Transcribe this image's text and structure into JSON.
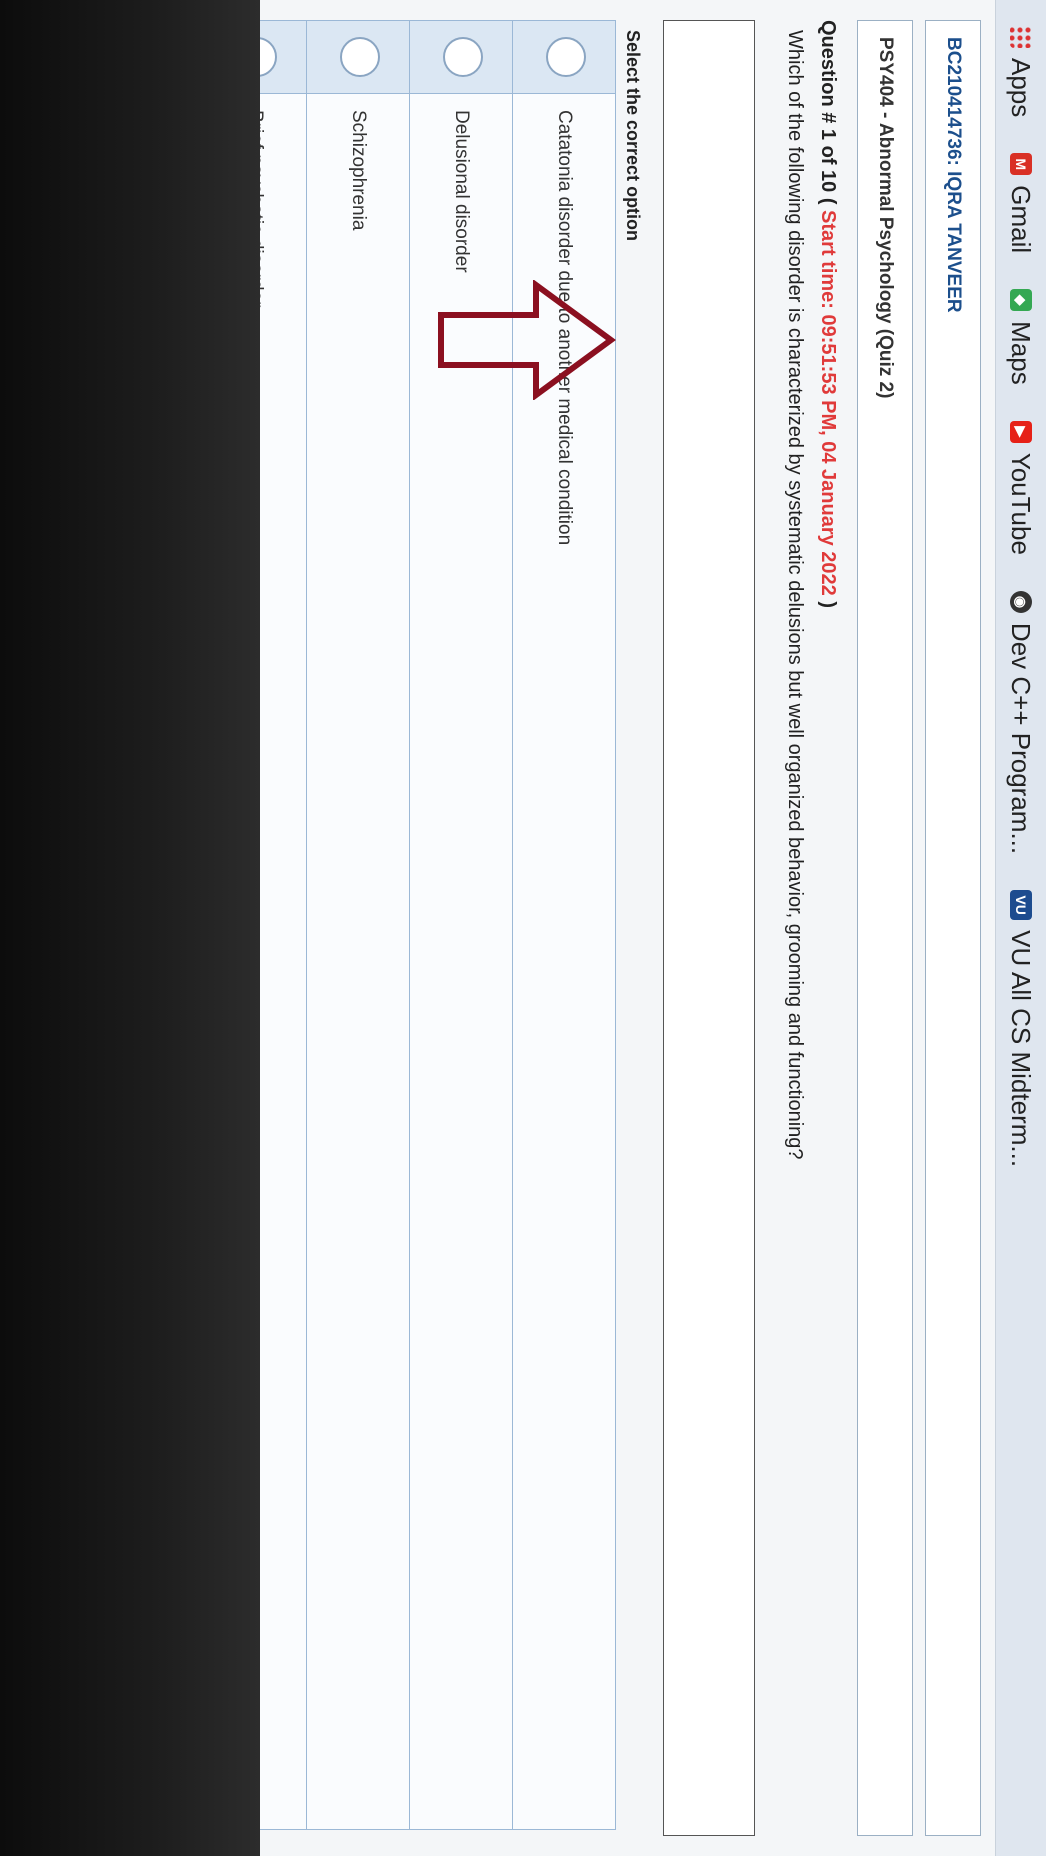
{
  "bookmarks": [
    {
      "label": "Apps",
      "icon": "apps-grid-icon"
    },
    {
      "label": "Gmail",
      "icon": "gmail-icon"
    },
    {
      "label": "Maps",
      "icon": "maps-icon"
    },
    {
      "label": "YouTube",
      "icon": "youtube-icon"
    },
    {
      "label": "Dev C++ Program...",
      "icon": "devcpp-icon"
    },
    {
      "label": "VU All CS Midterm...",
      "icon": "vu-icon"
    }
  ],
  "student": "BC210414736: IQRA TANVEER",
  "course": "PSY404 - Abnormal Psychology (Quiz 2)",
  "question": {
    "number_text": "Question # 1 of 10 (",
    "start_time": "Start time: 09:51:53 PM, 04 January 2022",
    "close_paren": ")",
    "text": "Which of the following disorder is characterized by systematic delusions but well organized behavior, grooming and functioning?"
  },
  "select_label": "Select the correct option",
  "options": [
    "Catatonia disorder due to another medical condition",
    "Delusional disorder",
    "Schizophrenia",
    "Brief psychotic disorder"
  ],
  "colors": {
    "accent": "#1c4f8c",
    "time": "#e03a3a",
    "arrow": "#8b1020"
  }
}
